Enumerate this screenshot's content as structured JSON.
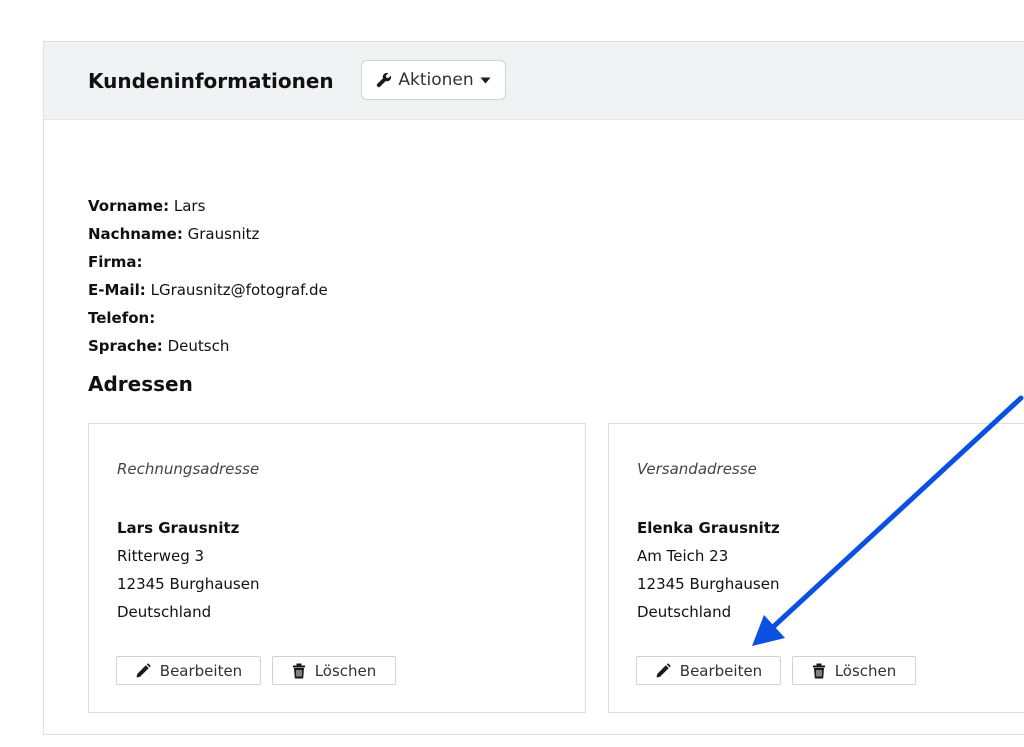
{
  "header": {
    "title": "Kundeninformationen",
    "actions_label": "Aktionen",
    "actions_icon": "wrench-icon",
    "dropdown_icon": "caret-down-icon"
  },
  "customer": {
    "fields": [
      {
        "label": "Vorname:",
        "value": "Lars"
      },
      {
        "label": "Nachname:",
        "value": "Grausnitz"
      },
      {
        "label": "Firma:",
        "value": ""
      },
      {
        "label": "E-Mail:",
        "value": "LGrausnitz@fotograf.de"
      },
      {
        "label": "Telefon:",
        "value": ""
      },
      {
        "label": "Sprache:",
        "value": "Deutsch"
      }
    ]
  },
  "addresses": {
    "title": "Adressen",
    "cards": [
      {
        "type": "Rechnungsadresse",
        "name": "Lars Grausnitz",
        "street": "Ritterweg 3",
        "city": "12345 Burghausen",
        "country": "Deutschland",
        "edit_label": "Bearbeiten",
        "delete_label": "Löschen"
      },
      {
        "type": "Versandadresse",
        "name": "Elenka Grausnitz",
        "street": "Am Teich 23",
        "city": "12345 Burghausen",
        "country": "Deutschland",
        "edit_label": "Bearbeiten",
        "delete_label": "Löschen"
      }
    ]
  },
  "annotation": {
    "arrow_color": "#0b50e0",
    "arrow_icon": "pointer-arrow-icon"
  }
}
